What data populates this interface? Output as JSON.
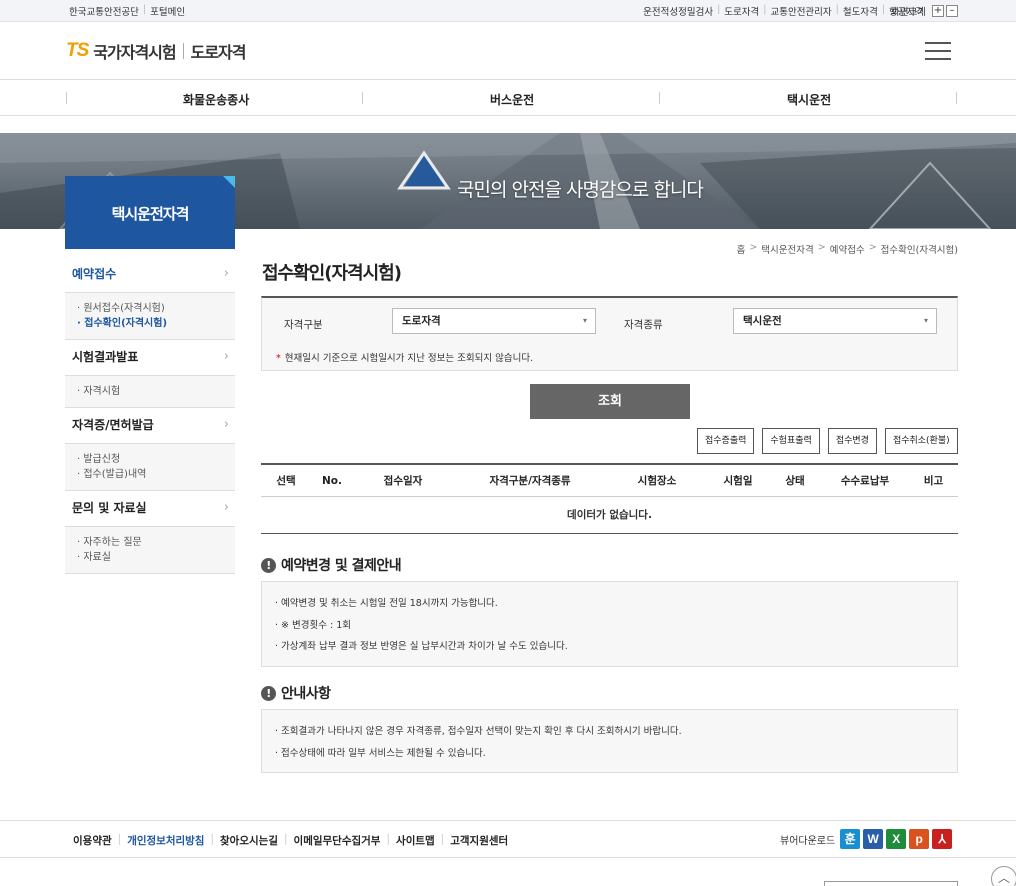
{
  "topbar": {
    "left_links": [
      "한국교통안전공단",
      "포털메인"
    ],
    "right_links": [
      "운전적성정밀검사",
      "도로자격",
      "교통안전관리자",
      "철도자격",
      "항공자격"
    ],
    "zoom_label": "화면크기",
    "zoom_in": "+",
    "zoom_out": "–"
  },
  "header": {
    "logo_ts": "TS",
    "logo_brand": "국가자격시험",
    "logo_sub": "도로자격"
  },
  "gnb": {
    "items": [
      "화물운송종사",
      "버스운전",
      "택시운전"
    ]
  },
  "banner": {
    "slogan": "국민의 안전을 사명감으로 합니다"
  },
  "sidebar": {
    "title": "택시운전자격",
    "menus": [
      {
        "label": "예약접수",
        "subs": [
          "· 원서접수(자격시험)",
          "· 접수확인(자격시험)"
        ]
      },
      {
        "label": "시험결과발표",
        "subs": [
          "· 자격시험"
        ]
      },
      {
        "label": "자격증/면허발급",
        "subs": [
          "· 발급신청",
          "· 접수(발급)내역"
        ]
      },
      {
        "label": "문의 및 자료실",
        "subs": [
          "· 자주하는 질문",
          "· 자료실"
        ]
      }
    ],
    "chevron": "›"
  },
  "breadcrumb": [
    "홈",
    "택시운전자격",
    "예약접수",
    "접수확인(자격시험)"
  ],
  "breadcrumb_sep": ">",
  "page_title": "접수확인(자격시험)",
  "search": {
    "label_category": "자격구분",
    "value_category": "도로자격",
    "label_type": "자격종류",
    "value_type": "택시운전",
    "arrow": "▾",
    "note_star": "*",
    "note": "현재일시 기준으로 시험일시가 지난 정보는 조회되지 않습니다.",
    "button": "조회"
  },
  "actions": [
    "접수증출력",
    "수험표출력",
    "접수변경",
    "접수취소(환불)"
  ],
  "grid": {
    "columns": [
      "선택",
      "No.",
      "접수일자",
      "자격구분/자격종류",
      "시험장소",
      "시험일",
      "상태",
      "수수료납부",
      "비고"
    ],
    "empty": "데이터가 없습니다."
  },
  "section1": {
    "icon": "!",
    "title": "예약변경 및 결제안내",
    "lines": [
      "· 예약변경 및 취소는 시험일 전일 18시까지 가능합니다.",
      "· ※ 변경횟수 : 1회",
      "· 가상계좌 납부 결과 정보 반영은 실 납부시간과 차이가 날 수도 있습니다."
    ]
  },
  "section2": {
    "icon": "!",
    "title": "안내사항",
    "lines": [
      "· 조회결과가 나타나지 않은 경우 자격종류, 접수일자 선택이 맞는지 확인 후 다시 조회하시기 바랍니다.",
      "· 접수상태에 따라 일부 서비스는 제한될 수 있습니다."
    ]
  },
  "footer": {
    "links": [
      "이용약관",
      "개인정보처리방침",
      "찾아오시는길",
      "이메일무단수집거부",
      "사이트맵",
      "고객지원센터"
    ],
    "viewer_label": "뷰어다운로드",
    "viewers": [
      {
        "glyph": "훈",
        "color": "#1a8fd0"
      },
      {
        "glyph": "W",
        "color": "#2a5ea8"
      },
      {
        "glyph": "X",
        "color": "#1f8c3c"
      },
      {
        "glyph": "p",
        "color": "#d9531e"
      },
      {
        "glyph": "⅄",
        "color": "#c8201f"
      }
    ],
    "scroll_top": "︿"
  }
}
